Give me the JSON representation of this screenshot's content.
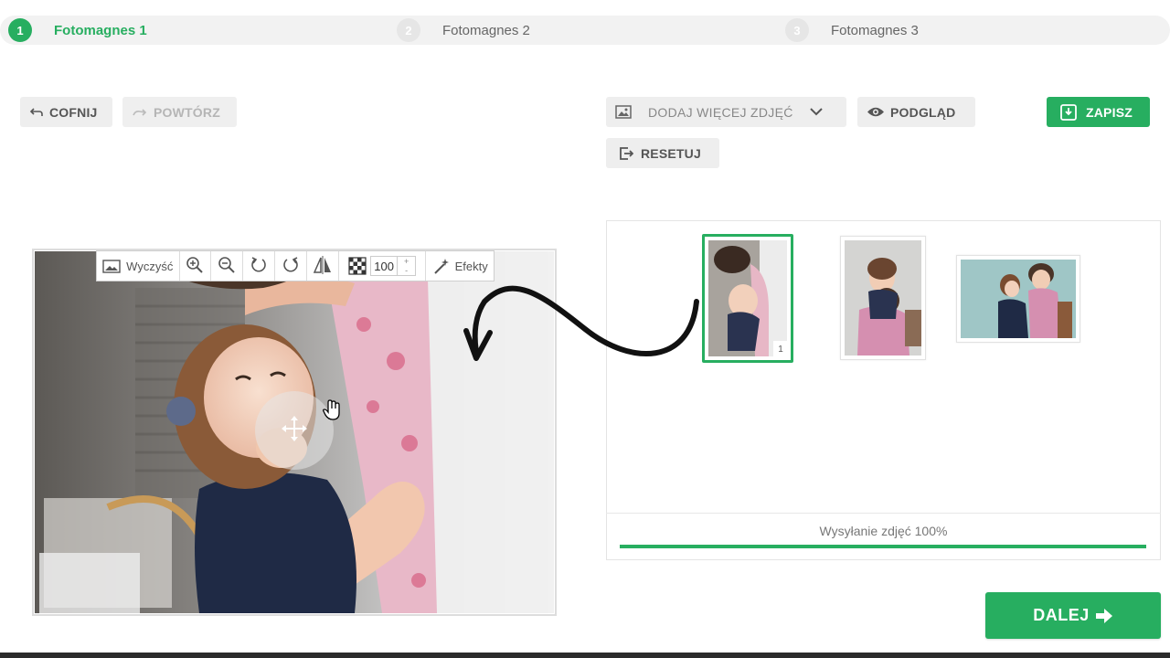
{
  "steps": [
    {
      "num": "1",
      "label": "Fotomagnes 1",
      "active": true
    },
    {
      "num": "2",
      "label": "Fotomagnes 2",
      "active": false
    },
    {
      "num": "3",
      "label": "Fotomagnes 3",
      "active": false
    }
  ],
  "toolbar_top": {
    "undo_label": "COFNIJ",
    "redo_label": "POWTÓRZ",
    "add_photos_label": "DODAJ WIĘCEJ ZDJĘĆ",
    "preview_label": "PODGLĄD",
    "save_label": "ZAPISZ",
    "reset_label": "RESETUJ"
  },
  "editor_toolbar": {
    "clear_label": "Wyczyść",
    "opacity_value": "100",
    "spin_up": "+",
    "spin_down": "-",
    "effects_label": "Efekty",
    "icons": [
      "image-icon",
      "zoom-in-icon",
      "zoom-out-icon",
      "rotate-left-icon",
      "rotate-right-icon",
      "flip-icon",
      "transparency-icon",
      "magic-wand-icon"
    ]
  },
  "thumbnails": [
    {
      "badge": "1",
      "selected": true
    },
    {
      "selected": false
    },
    {
      "selected": false
    }
  ],
  "upload": {
    "status_text": "Wysyłanie zdjęć 100%",
    "progress": 1.0
  },
  "next_label": "DALEJ",
  "colors": {
    "accent": "#27ae60",
    "button_bg": "#eeeeee",
    "text": "#555555"
  }
}
